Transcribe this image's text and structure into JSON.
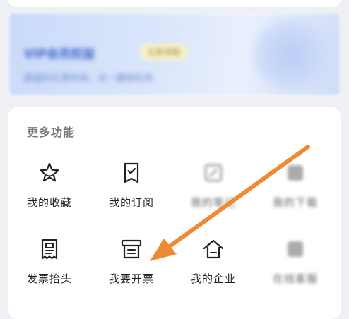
{
  "promo": {
    "title": "VIP会员权益",
    "badge": "立即领取",
    "subtitle": "超值好礼等你来，点一键轻松领"
  },
  "functions": {
    "section_title": "更多功能",
    "items": [
      {
        "label": "我的收藏",
        "icon": "star-icon"
      },
      {
        "label": "我的订阅",
        "icon": "subscription-icon"
      },
      {
        "label": "我的笔记",
        "icon": "note-icon"
      },
      {
        "label": "我的下载",
        "icon": "download-icon"
      },
      {
        "label": "发票抬头",
        "icon": "invoice-title-icon"
      },
      {
        "label": "我要开票",
        "icon": "issue-invoice-icon"
      },
      {
        "label": "我的企业",
        "icon": "enterprise-icon"
      },
      {
        "label": "在线客服",
        "icon": "service-icon"
      }
    ]
  },
  "colors": {
    "accent_arrow": "#f08a32",
    "page_bg": "#eef0f4",
    "card_bg": "#ffffff",
    "icon_stroke": "#222222"
  }
}
